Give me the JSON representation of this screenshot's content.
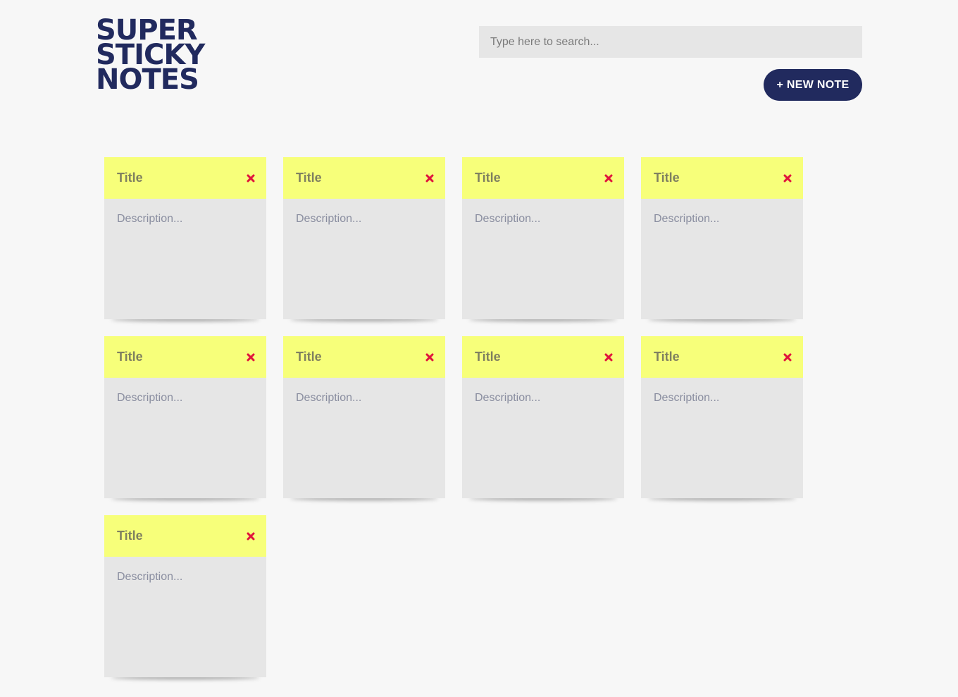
{
  "header": {
    "logo_lines": [
      "SUPER",
      "STICKY",
      "NOTES"
    ],
    "search_placeholder": "Type here to search...",
    "new_note_label": "+ NEW NOTE"
  },
  "notes": [
    {
      "title_placeholder": "Title",
      "description_placeholder": "Description...",
      "close_icon": "close-icon"
    },
    {
      "title_placeholder": "Title",
      "description_placeholder": "Description...",
      "close_icon": "close-icon"
    },
    {
      "title_placeholder": "Title",
      "description_placeholder": "Description...",
      "close_icon": "close-icon"
    },
    {
      "title_placeholder": "Title",
      "description_placeholder": "Description...",
      "close_icon": "close-icon"
    },
    {
      "title_placeholder": "Title",
      "description_placeholder": "Description...",
      "close_icon": "close-icon"
    },
    {
      "title_placeholder": "Title",
      "description_placeholder": "Description...",
      "close_icon": "close-icon"
    },
    {
      "title_placeholder": "Title",
      "description_placeholder": "Description...",
      "close_icon": "close-icon"
    },
    {
      "title_placeholder": "Title",
      "description_placeholder": "Description...",
      "close_icon": "close-icon"
    },
    {
      "title_placeholder": "Title",
      "description_placeholder": "Description...",
      "close_icon": "close-icon"
    }
  ],
  "colors": {
    "brand": "#212a5e",
    "note_header": "#f7ff7a",
    "note_body": "#e6e6e6",
    "close": "#e0143c",
    "background": "#f7f7f7"
  }
}
